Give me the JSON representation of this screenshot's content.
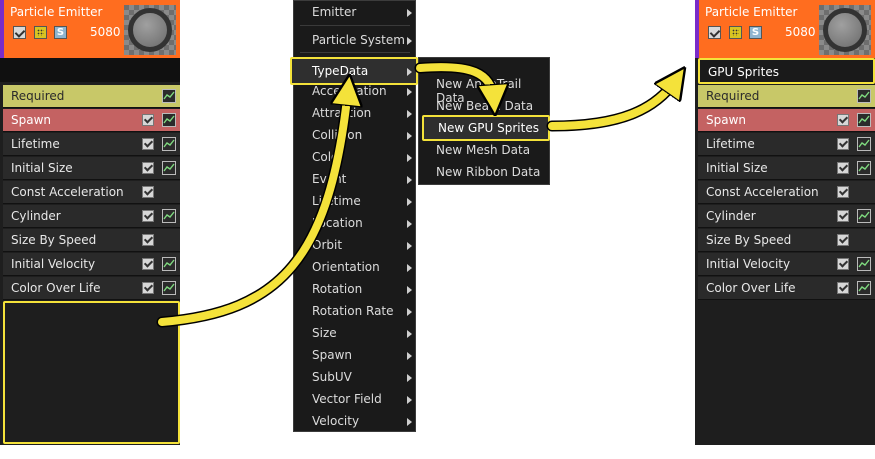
{
  "left_panel": {
    "header": {
      "title": "Particle Emitter",
      "count": "5080",
      "s_icon": "S"
    },
    "modules": [
      {
        "label": "Required",
        "style": "required",
        "checkbox": false,
        "graph": true
      },
      {
        "label": "Spawn",
        "style": "spawn",
        "checkbox": true,
        "graph": true
      },
      {
        "label": "Lifetime",
        "style": "plain",
        "checkbox": true,
        "graph": true
      },
      {
        "label": "Initial Size",
        "style": "plain",
        "checkbox": true,
        "graph": true
      },
      {
        "label": "Const Acceleration",
        "style": "plain",
        "checkbox": true,
        "graph": false
      },
      {
        "label": "Cylinder",
        "style": "plain",
        "checkbox": true,
        "graph": true
      },
      {
        "label": "Size By Speed",
        "style": "plain",
        "checkbox": true,
        "graph": false
      },
      {
        "label": "Initial Velocity",
        "style": "plain",
        "checkbox": true,
        "graph": true
      },
      {
        "label": "Color Over Life",
        "style": "plain",
        "checkbox": true,
        "graph": true
      }
    ]
  },
  "context_menu": {
    "items": [
      {
        "label": "Emitter",
        "submenu": true
      },
      {
        "label": "Particle System",
        "submenu": true
      },
      {
        "label": "TypeData",
        "submenu": true,
        "highlighted": true
      },
      {
        "label": "Acceleration",
        "submenu": true
      },
      {
        "label": "Attraction",
        "submenu": true
      },
      {
        "label": "Collision",
        "submenu": true
      },
      {
        "label": "Color",
        "submenu": true
      },
      {
        "label": "Event",
        "submenu": true
      },
      {
        "label": "Lifetime",
        "submenu": true
      },
      {
        "label": "Location",
        "submenu": true
      },
      {
        "label": "Orbit",
        "submenu": true
      },
      {
        "label": "Orientation",
        "submenu": true
      },
      {
        "label": "Rotation",
        "submenu": true
      },
      {
        "label": "Rotation Rate",
        "submenu": true
      },
      {
        "label": "Size",
        "submenu": true
      },
      {
        "label": "Spawn",
        "submenu": true
      },
      {
        "label": "SubUV",
        "submenu": true
      },
      {
        "label": "Vector Field",
        "submenu": true
      },
      {
        "label": "Velocity",
        "submenu": true
      }
    ]
  },
  "typedata_submenu": {
    "items": [
      {
        "label": "New AnimTrail Data"
      },
      {
        "label": "New Beam Data"
      },
      {
        "label": "New GPU Sprites",
        "highlighted": true
      },
      {
        "label": "New Mesh Data"
      },
      {
        "label": "New Ribbon Data"
      }
    ]
  },
  "right_panel": {
    "header": {
      "title": "Particle Emitter",
      "count": "5080",
      "s_icon": "S"
    },
    "type_data_module": "GPU Sprites",
    "modules": [
      {
        "label": "Required",
        "style": "required",
        "checkbox": false,
        "graph": true
      },
      {
        "label": "Spawn",
        "style": "spawn",
        "checkbox": true,
        "graph": true
      },
      {
        "label": "Lifetime",
        "style": "plain",
        "checkbox": true,
        "graph": true
      },
      {
        "label": "Initial Size",
        "style": "plain",
        "checkbox": true,
        "graph": true
      },
      {
        "label": "Const Acceleration",
        "style": "plain",
        "checkbox": true,
        "graph": false
      },
      {
        "label": "Cylinder",
        "style": "plain",
        "checkbox": true,
        "graph": true
      },
      {
        "label": "Size By Speed",
        "style": "plain",
        "checkbox": true,
        "graph": false
      },
      {
        "label": "Initial Velocity",
        "style": "plain",
        "checkbox": true,
        "graph": true
      },
      {
        "label": "Color Over Life",
        "style": "plain",
        "checkbox": true,
        "graph": true
      }
    ]
  },
  "colors": {
    "highlight": "#f4e23a",
    "header": "#ff6d1f",
    "required": "#c8c868",
    "spawn": "#c46262"
  }
}
